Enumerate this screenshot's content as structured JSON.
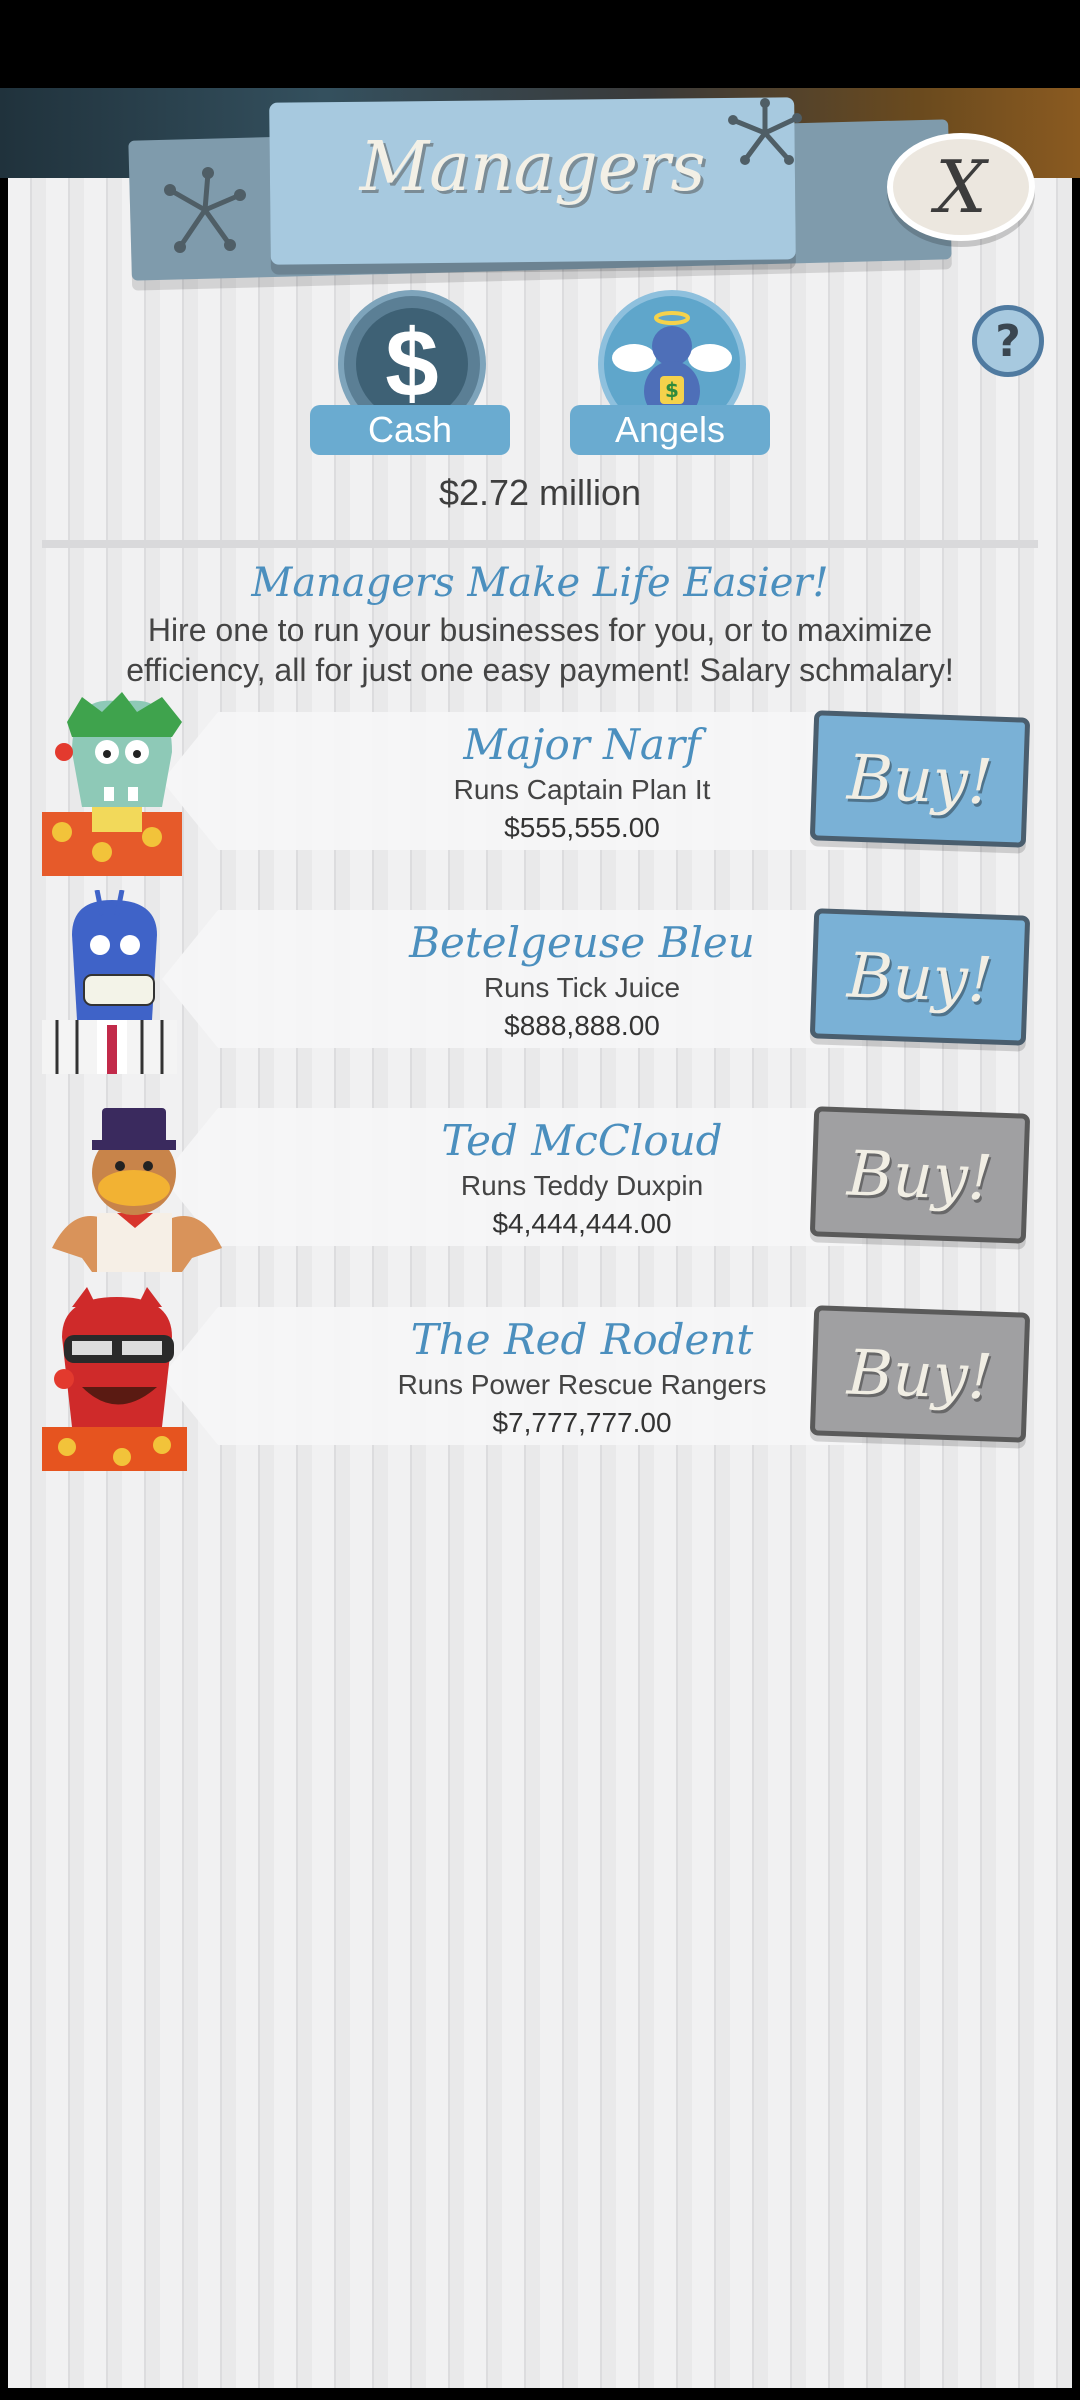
{
  "header": {
    "title": "Managers",
    "close_symbol": "X",
    "help_symbol": "?"
  },
  "tabs": [
    {
      "label": "Cash",
      "icon": "dollar-icon",
      "symbol": "$"
    },
    {
      "label": "Angels",
      "icon": "angel-bear-icon"
    }
  ],
  "cash_amount": "$2.72 million",
  "intro": {
    "tagline": "Managers Make Life Easier!",
    "text": "Hire one to run your businesses for you, or to maximize efficiency, all for just one easy payment! Salary schmalary!"
  },
  "managers": [
    {
      "name": "Major Narf",
      "runs": "Runs Captain Plan It",
      "price": "$555,555.00",
      "buy_label": "Buy!",
      "affordable": true
    },
    {
      "name": "Betelgeuse Bleu",
      "runs": "Runs Tick Juice",
      "price": "$888,888.00",
      "buy_label": "Buy!",
      "affordable": true
    },
    {
      "name": "Ted McCloud",
      "runs": "Runs Teddy Duxpin",
      "price": "$4,444,444.00",
      "buy_label": "Buy!",
      "affordable": false
    },
    {
      "name": "The Red Rodent",
      "runs": "Runs Power Rescue Rangers",
      "price": "$7,777,777.00",
      "buy_label": "Buy!",
      "affordable": false
    }
  ],
  "colors": {
    "accent_blue": "#4b8fbe",
    "buy_active": "#7ab1d6",
    "buy_locked": "#a0a0a2"
  }
}
